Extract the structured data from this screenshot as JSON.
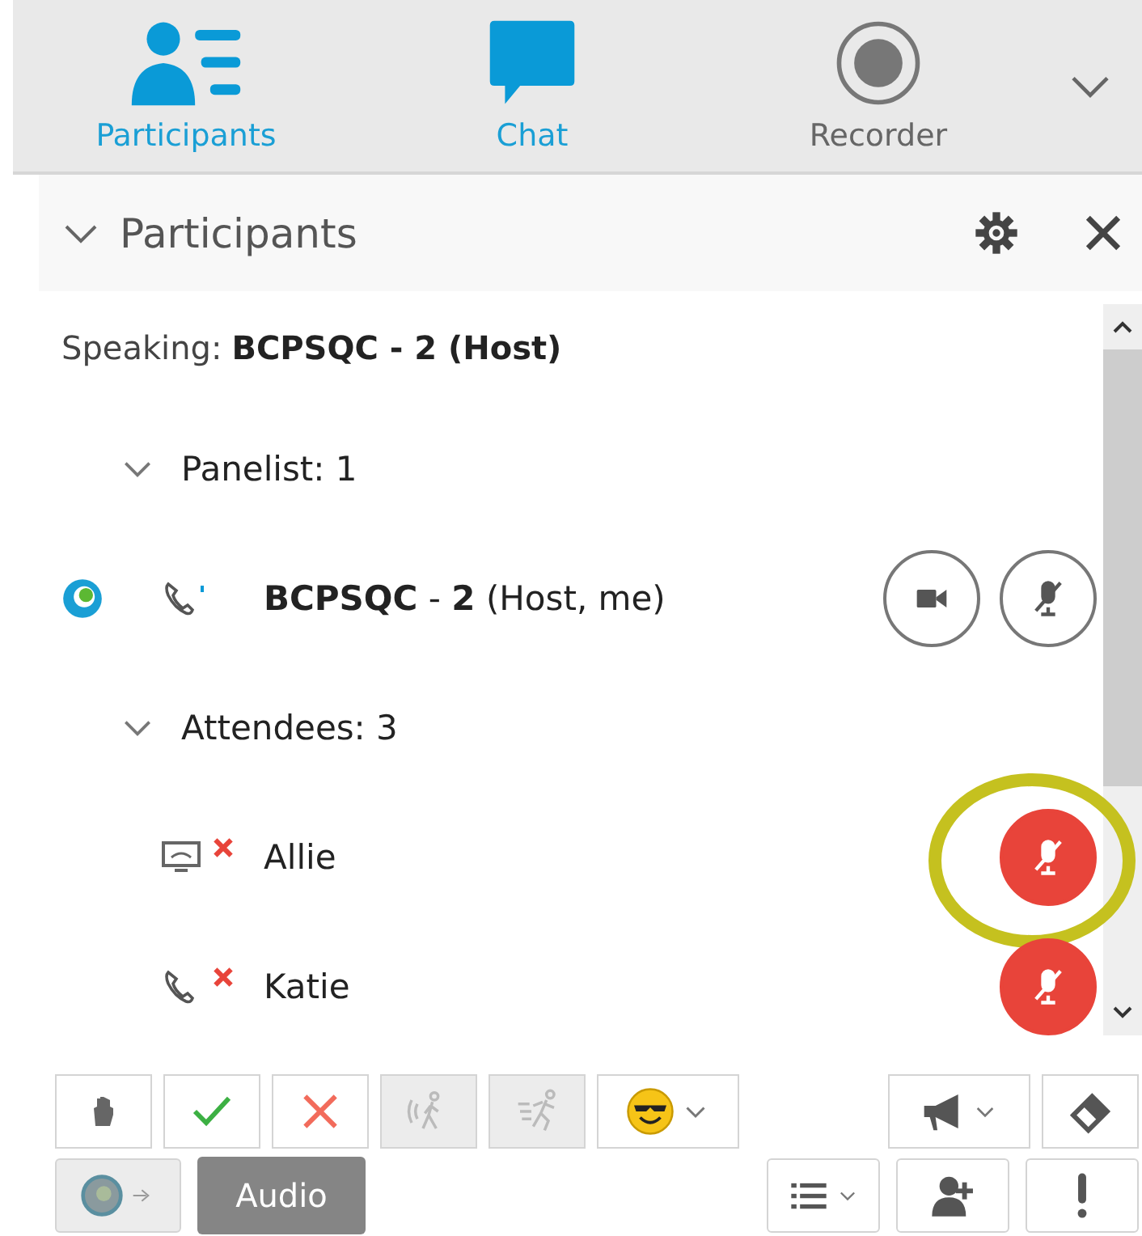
{
  "tabs": [
    {
      "label": "Participants",
      "kind": "people",
      "selected": true
    },
    {
      "label": "Chat",
      "kind": "chat",
      "selected": true
    },
    {
      "label": "Recorder",
      "kind": "record",
      "selected": false
    }
  ],
  "panel": {
    "title": "Participants"
  },
  "speaking": {
    "label": "Speaking:",
    "name": "BCPSQC - 2 (Host)"
  },
  "groups": [
    {
      "label": "Panelist: 1",
      "expanded": true,
      "members": [
        {
          "name": "**BCPSQC** - **2** (Host, me)",
          "kind": "phone",
          "presenter": true,
          "video": true,
          "muted": false
        }
      ]
    },
    {
      "label": "Attendees: 3",
      "expanded": true,
      "members": [
        {
          "name": "Allie",
          "kind": "computer",
          "disconnected": true,
          "muted": true,
          "highlighted": true
        },
        {
          "name": "Katie",
          "kind": "phone",
          "disconnected": true,
          "muted": true
        }
      ]
    }
  ],
  "toolbar_top": {
    "left": [
      {
        "kind": "hand"
      },
      {
        "kind": "check"
      },
      {
        "kind": "cross"
      },
      {
        "kind": "walk",
        "disabled": true
      },
      {
        "kind": "run",
        "disabled": true
      },
      {
        "kind": "emoji"
      }
    ],
    "right": [
      {
        "kind": "megaphone"
      },
      {
        "kind": "eraser"
      }
    ]
  },
  "toolbar_bottom": {
    "left": [
      {
        "kind": "status",
        "disabled": true
      },
      {
        "kind": "audio",
        "label": "Audio"
      }
    ],
    "right": [
      {
        "kind": "list"
      },
      {
        "kind": "add-person"
      },
      {
        "kind": "alert"
      }
    ]
  }
}
